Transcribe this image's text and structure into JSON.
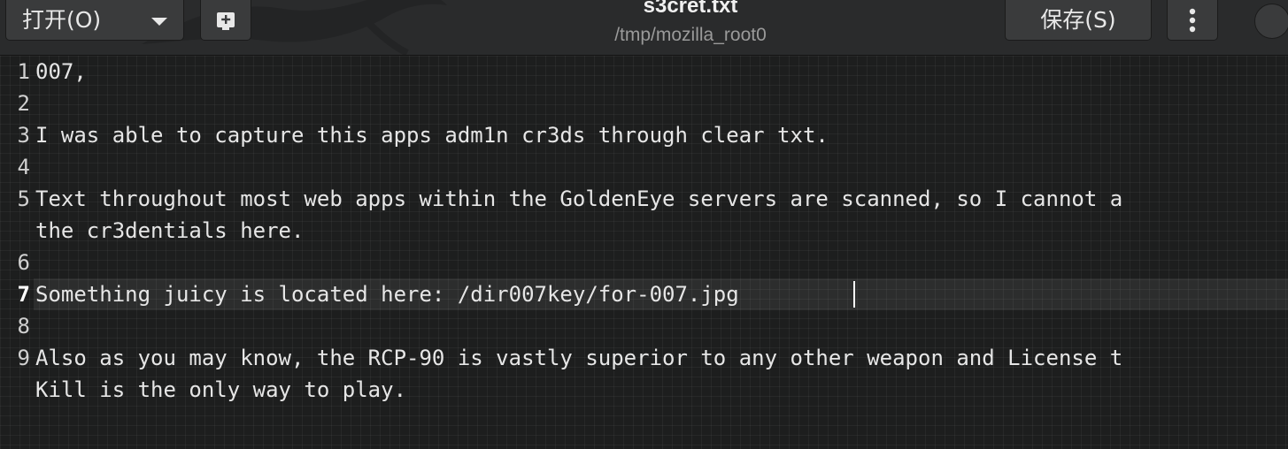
{
  "header": {
    "open_label": "打开(O)",
    "save_label": "保存(S)",
    "title": "s3cret.txt",
    "subtitle": "/tmp/mozilla_root0"
  },
  "editor": {
    "current_line": 7,
    "line_numbers": [
      "1",
      "2",
      "3",
      "4",
      "5",
      "6",
      "7",
      "8",
      "9"
    ],
    "lines": [
      "007,",
      "",
      "I was able to capture this apps adm1n cr3ds through clear txt.",
      "",
      "Text throughout most web apps within the GoldenEye servers are scanned, so I cannot a",
      "the cr3dentials here.",
      "",
      "Something juicy is located here: /dir007key/for-007.jpg",
      "",
      "Also as you may know, the RCP-90 is vastly superior to any other weapon and License t",
      "Kill is the only way to play."
    ]
  },
  "colors": {
    "background": "#1d1e1e",
    "headerbar": "#2a2b2c",
    "button": "#3a3b3c",
    "text": "#e6e6e6"
  },
  "icons": {
    "open_dropdown": "chevron-down-icon",
    "new_document": "new-document-icon",
    "menu": "vertical-dots-icon"
  }
}
